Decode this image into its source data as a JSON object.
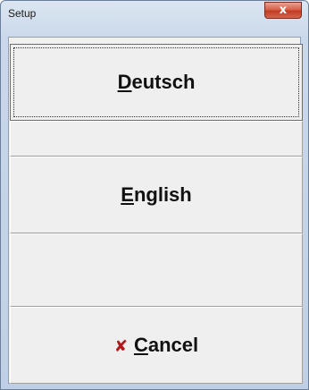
{
  "window": {
    "title": "Setup",
    "close_glyph": "x"
  },
  "buttons": {
    "deutsch": {
      "label": "Deutsch"
    },
    "english": {
      "label": "English"
    },
    "cancel": {
      "label": "Cancel",
      "icon": "cancel-x-icon",
      "icon_glyph": "✘",
      "icon_color": "#b3181b"
    }
  }
}
